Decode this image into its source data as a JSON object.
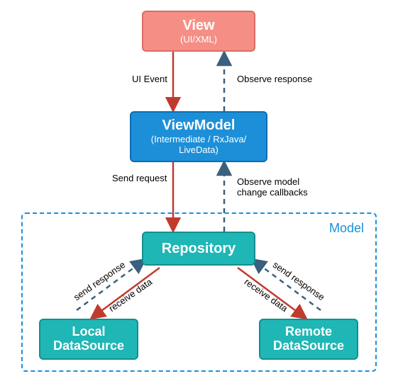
{
  "nodes": {
    "view": {
      "title": "View",
      "sub": "(UI/XML)"
    },
    "viewmodel": {
      "title": "ViewModel",
      "sub": "(Intermediate / RxJava/\nLiveData)"
    },
    "repository": {
      "title": "Repository"
    },
    "local": {
      "title": "Local\nDataSource"
    },
    "remote": {
      "title": "Remote\nDataSource"
    }
  },
  "frame": {
    "label": "Model"
  },
  "edges": {
    "ui_event": "UI Event",
    "observe_response": "Observe response",
    "send_request": "Send request",
    "observe_model": "Observe model\nchange callbacks",
    "receive_data_left": "receive data",
    "send_response_left": "send response",
    "receive_data_right": "receive data",
    "send_response_right": "send response"
  },
  "colors": {
    "solid_arrow": "#c23a2e",
    "dashed_arrow": "#39607f",
    "frame": "#1d8fd8"
  }
}
